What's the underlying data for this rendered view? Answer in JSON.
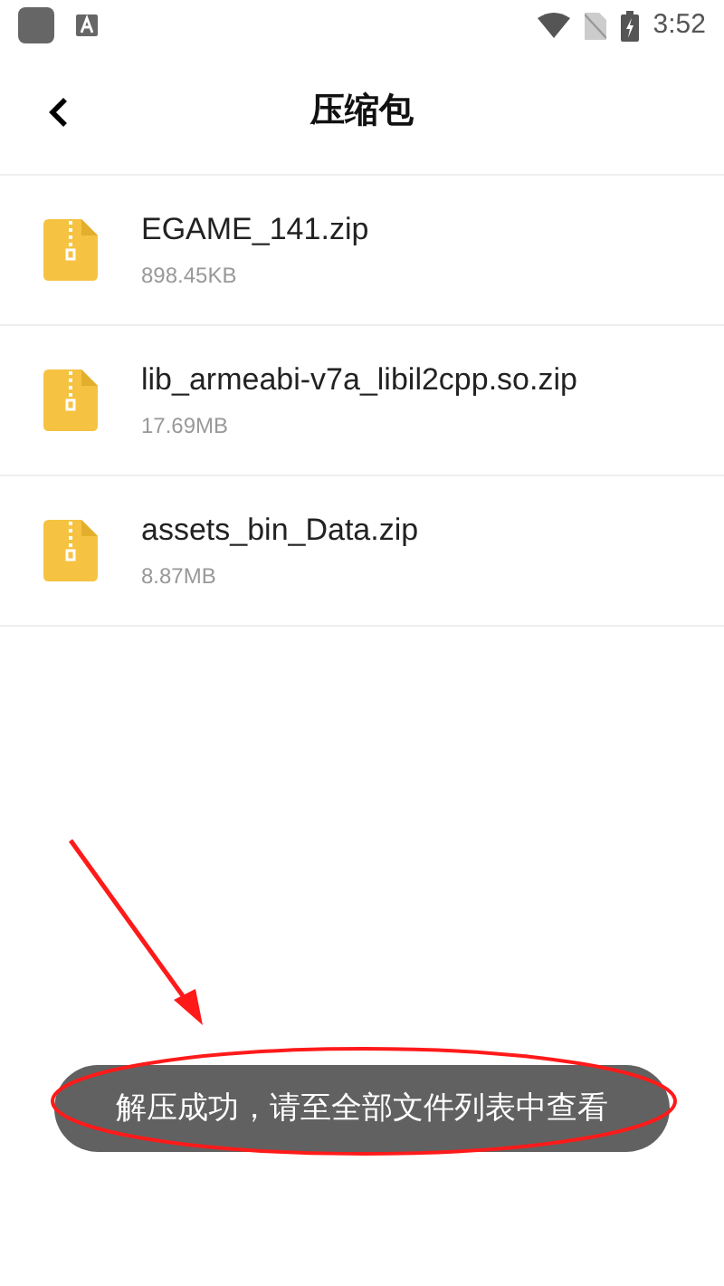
{
  "status_bar": {
    "time": "3:52"
  },
  "header": {
    "title": "压缩包"
  },
  "files": [
    {
      "name": "EGAME_141.zip",
      "size": "898.45KB"
    },
    {
      "name": "lib_armeabi-v7a_libil2cpp.so.zip",
      "size": "17.69MB"
    },
    {
      "name": "assets_bin_Data.zip",
      "size": "8.87MB"
    }
  ],
  "toast": {
    "text": "解压成功，请至全部文件列表中查看"
  }
}
